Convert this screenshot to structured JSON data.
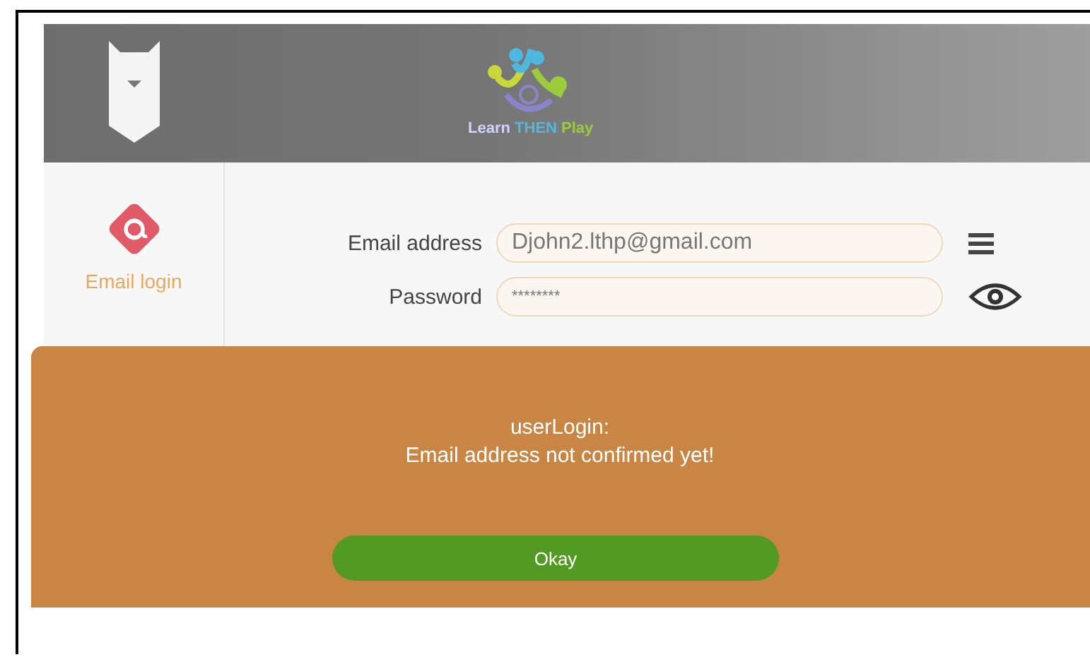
{
  "header": {
    "logo_text": [
      {
        "text": "Learn",
        "color": "#d4d0ff"
      },
      {
        "text": " THEN",
        "color": "#4fb8e0"
      },
      {
        "text": " Play",
        "color": "#9ccc3c"
      }
    ]
  },
  "sidebar": {
    "items": [
      {
        "label": "Email login"
      }
    ]
  },
  "form": {
    "fields": [
      {
        "label": "Email address",
        "value": "Djohn2.lthp@gmail.com",
        "kind": "menu"
      },
      {
        "label": "Password",
        "value": "********",
        "kind": "reveal"
      }
    ]
  },
  "dialog": {
    "title": "userLogin:",
    "message": "Email address not confirmed yet!",
    "button": "Okay"
  }
}
